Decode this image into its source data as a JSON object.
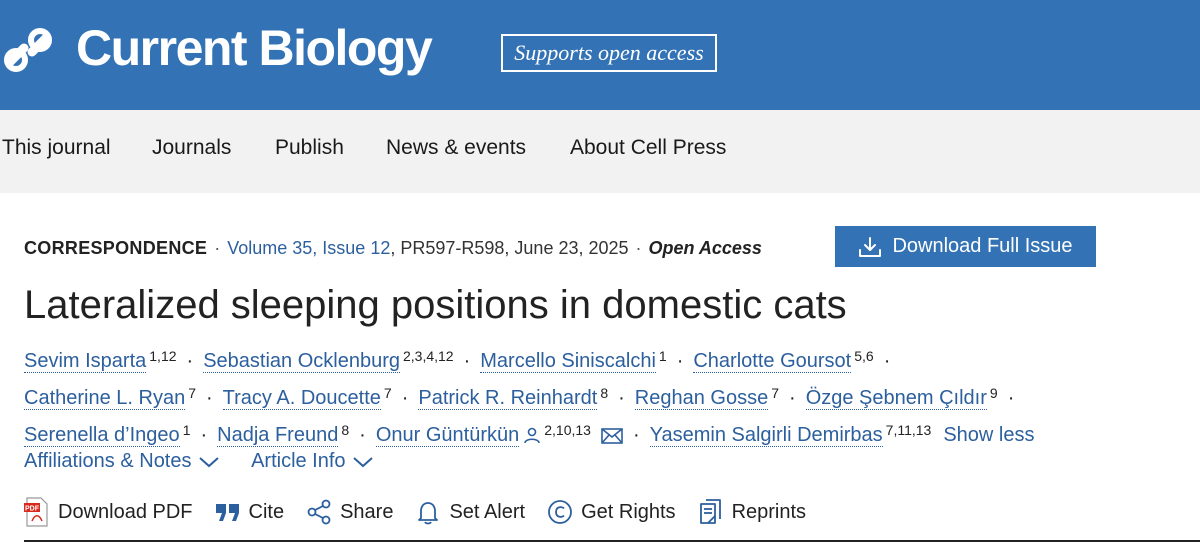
{
  "header": {
    "brand": "Current Biology",
    "badge": "Supports open access",
    "bg_color": "#3373b5"
  },
  "nav": {
    "items": [
      "This journal",
      "Journals",
      "Publish",
      "News & events",
      "About Cell Press"
    ]
  },
  "article": {
    "type": "CORRESPONDENCE",
    "volume": "Volume 35, Issue 12",
    "pages_date": "PR597-R598, June 23, 2025",
    "access": "Open Access",
    "download_issue_label": "Download Full Issue",
    "title": "Lateralized sleeping positions in domestic cats"
  },
  "authors": [
    {
      "name": "Sevim Isparta",
      "aff": "1,12"
    },
    {
      "name": "Sebastian Ocklenburg",
      "aff": "2,3,4,12"
    },
    {
      "name": "Marcello Siniscalchi",
      "aff": "1"
    },
    {
      "name": "Charlotte Goursot",
      "aff": "5,6"
    },
    {
      "name": "Catherine L. Ryan",
      "aff": "7"
    },
    {
      "name": "Tracy A. Doucette",
      "aff": "7"
    },
    {
      "name": "Patrick R. Reinhardt",
      "aff": "8"
    },
    {
      "name": "Reghan Gosse",
      "aff": "7"
    },
    {
      "name": "Özge Şebnem Çıldır",
      "aff": "9"
    },
    {
      "name": "Serenella d’Ingeo",
      "aff": "1"
    },
    {
      "name": "Nadja Freund",
      "aff": "8"
    },
    {
      "name": "Onur Güntürkün",
      "aff": "2,10,13"
    },
    {
      "name": "Yasemin Salgirli Demirbas",
      "aff": "7,11,13"
    }
  ],
  "show_less": "Show less",
  "toggles": {
    "affiliations": "Affiliations & Notes",
    "article_info": "Article Info"
  },
  "tools": {
    "pdf": "Download PDF",
    "cite": "Cite",
    "share": "Share",
    "alert": "Set Alert",
    "rights": "Get Rights",
    "reprints": "Reprints"
  }
}
